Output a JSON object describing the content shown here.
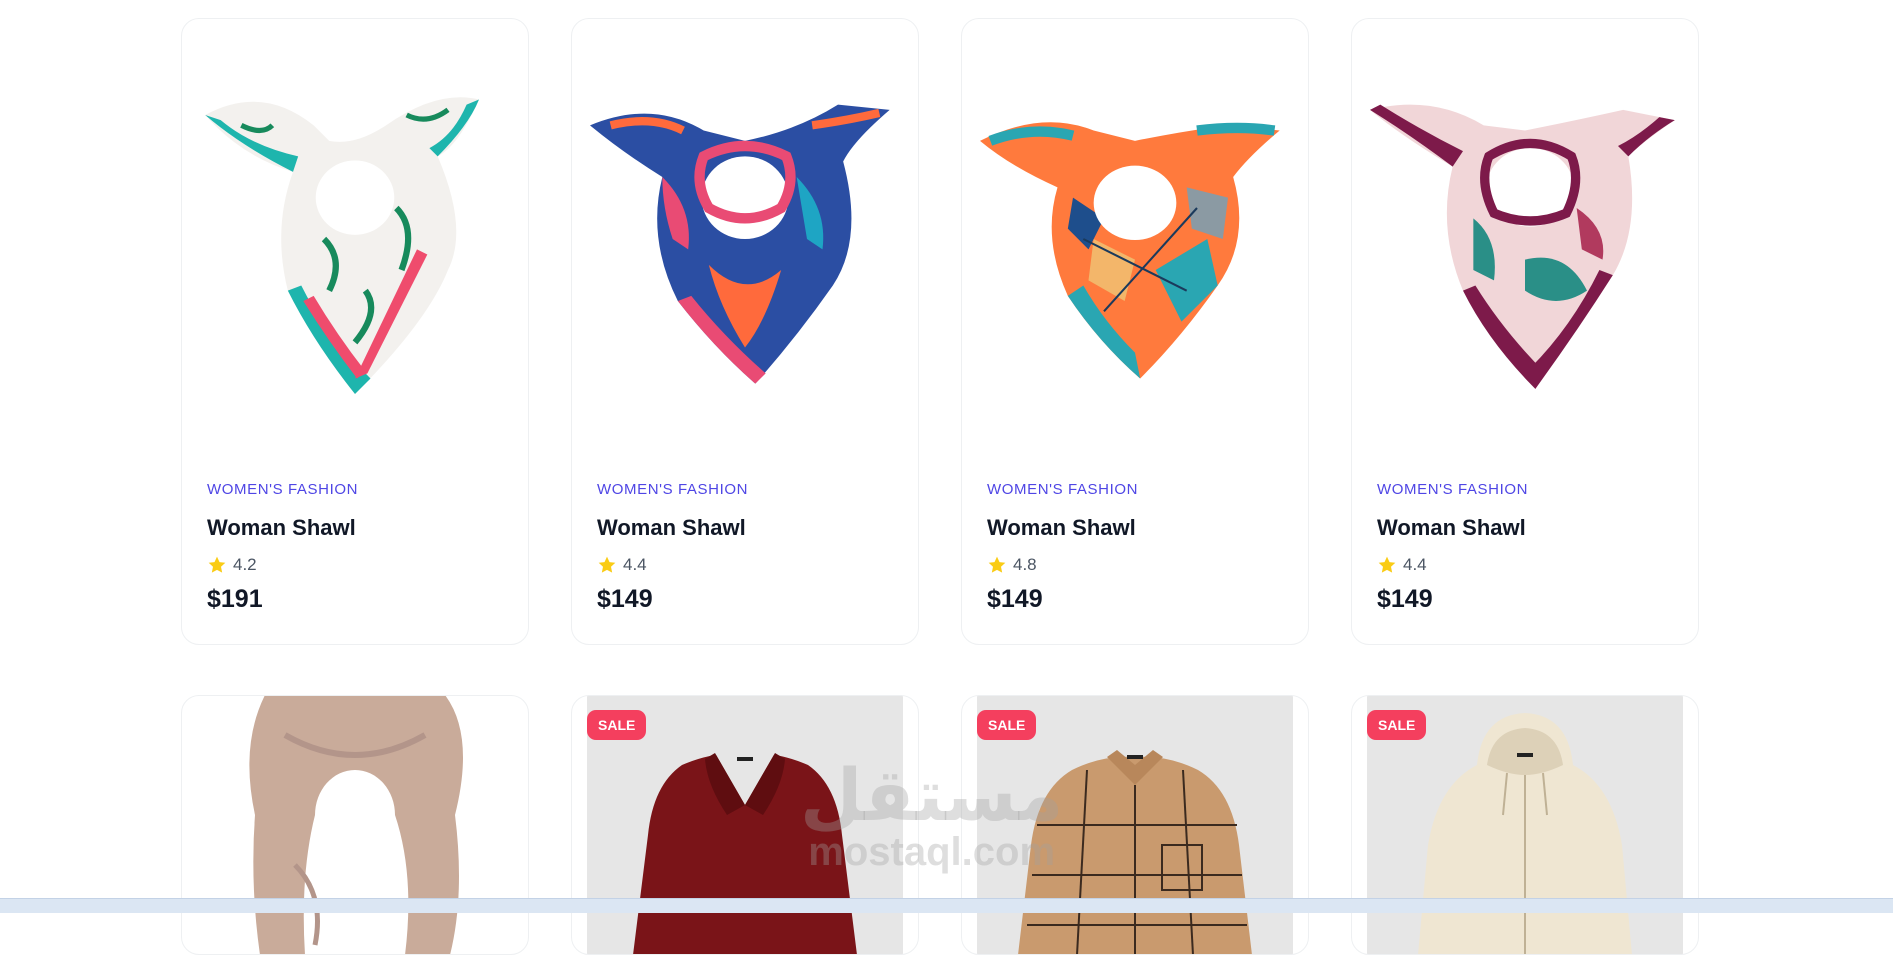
{
  "products": [
    {
      "category": "WOMEN'S FASHION",
      "name": "Woman Shawl",
      "rating": "4.2",
      "price": "$191",
      "image": "floral-white-teal-scarf"
    },
    {
      "category": "WOMEN'S FASHION",
      "name": "Woman Shawl",
      "rating": "4.4",
      "price": "$149",
      "image": "blue-pink-orange-scarf"
    },
    {
      "category": "WOMEN'S FASHION",
      "name": "Woman Shawl",
      "rating": "4.8",
      "price": "$149",
      "image": "geometric-orange-teal-scarf"
    },
    {
      "category": "WOMEN'S FASHION",
      "name": "Woman Shawl",
      "rating": "4.4",
      "price": "$149",
      "image": "burgundy-pink-leaf-scarf"
    }
  ],
  "row2": [
    {
      "image": "beige-chiffon-scarf"
    },
    {
      "badge": "SALE",
      "image": "burgundy-blouse"
    },
    {
      "badge": "SALE",
      "image": "plaid-tan-shirt"
    },
    {
      "badge": "SALE",
      "image": "cream-zip-hoodie"
    }
  ],
  "watermark": {
    "line1": "مستقل",
    "line2": "mostaql.com"
  },
  "colors": {
    "category": "#4f46e5",
    "star": "#facc15",
    "sale": "#f43f5e"
  }
}
